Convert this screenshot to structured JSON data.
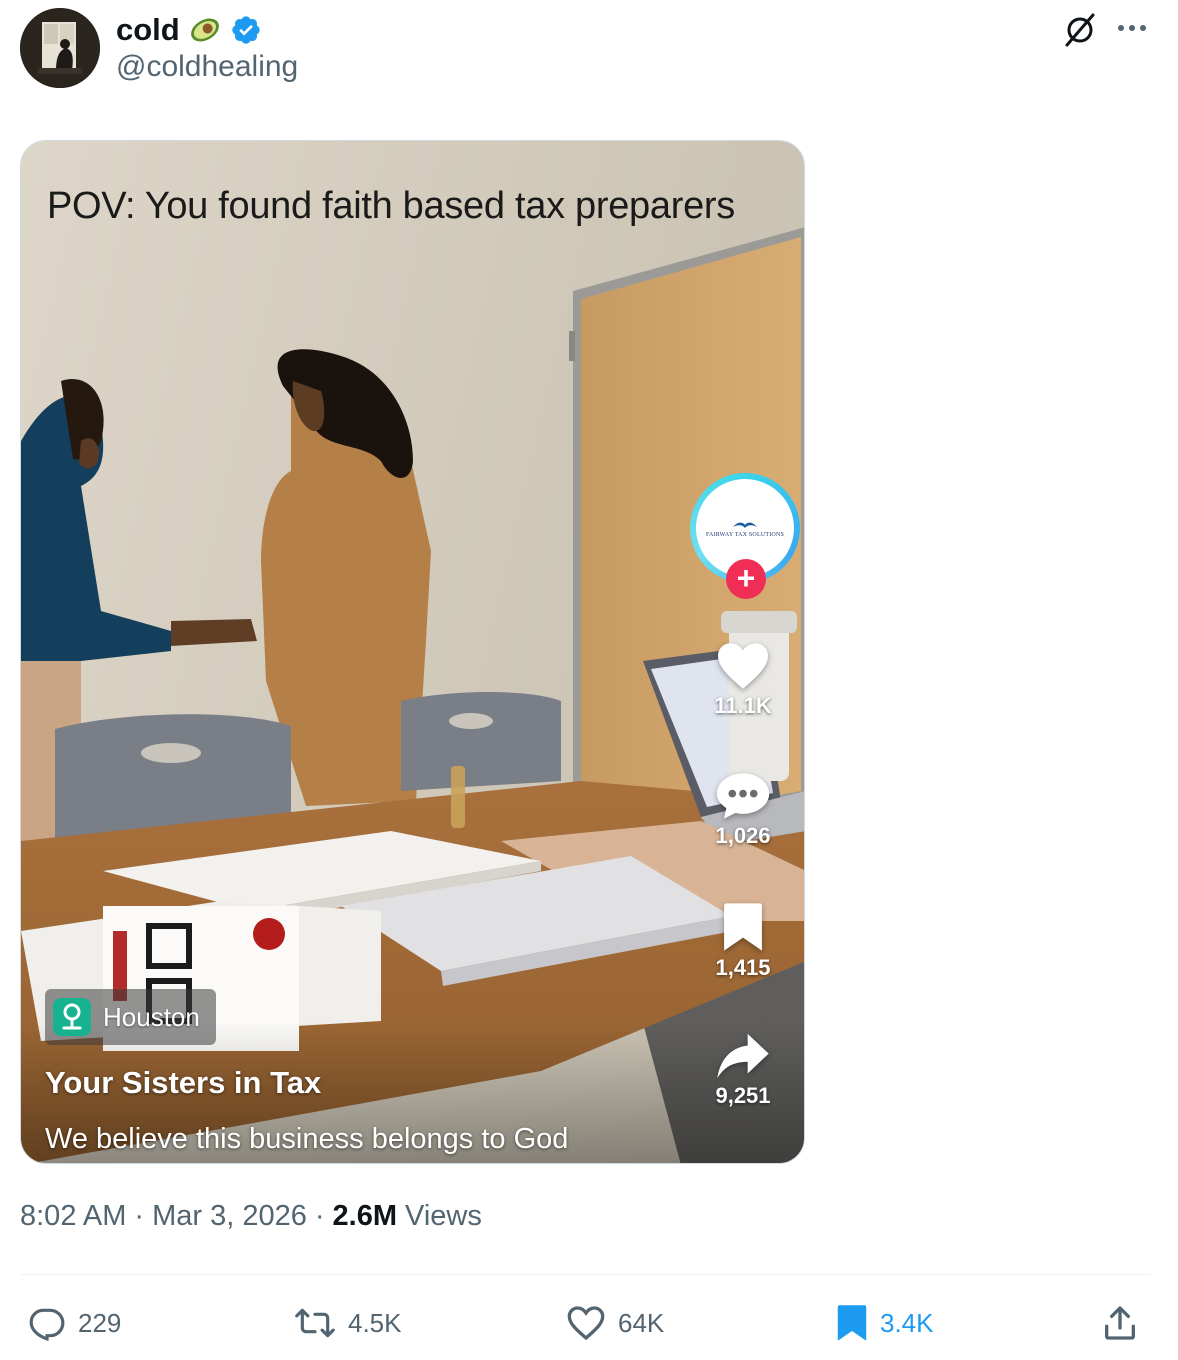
{
  "author": {
    "display_name": "cold",
    "emoji_icon": "avocado-icon",
    "verified": true,
    "handle": "@coldhealing"
  },
  "header_icons": [
    "grok-icon",
    "more-icon"
  ],
  "video": {
    "overlay_caption": "POV: You found faith based tax preparers",
    "profile_badge_text": "FAIRWAY TAX SOLUTIONS",
    "actions": {
      "likes": "11.1K",
      "comments": "1,026",
      "saves": "1,415",
      "shares": "9,251"
    },
    "location": "Houston",
    "author_name": "Your Sisters in Tax",
    "description": "We believe this business belongs to God"
  },
  "meta": {
    "time": "8:02 AM",
    "separator": "·",
    "date": "Mar 3, 2026",
    "views_count": "2.6M",
    "views_label": "Views"
  },
  "engagement": {
    "replies": "229",
    "reposts": "4.5K",
    "likes": "64K",
    "bookmarks": "3.4K"
  },
  "colors": {
    "verified_blue": "#1d9bf0",
    "secondary_text": "#536471",
    "tiktok_red": "#ef2d55"
  }
}
